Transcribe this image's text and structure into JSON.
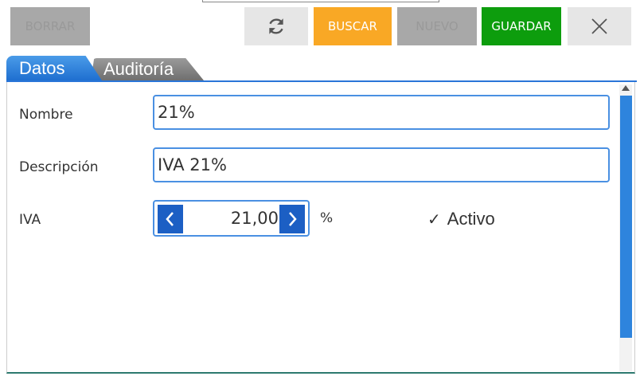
{
  "toolbar": {
    "borrar": "BORRAR",
    "buscar": "BUSCAR",
    "nuevo": "NUEVO",
    "guardar": "GUARDAR",
    "refresh_icon": "refresh-icon",
    "close_icon": "close-icon"
  },
  "tabs": [
    {
      "label": "Datos",
      "active": true
    },
    {
      "label": "Auditoría",
      "active": false
    }
  ],
  "form": {
    "nombre_label": "Nombre",
    "nombre_value": "21%",
    "descripcion_label": "Descripción",
    "descripcion_value": "IVA 21%",
    "iva_label": "IVA",
    "iva_value": "21,00",
    "iva_unit": "%",
    "activo_label": "Activo",
    "activo_checked": true
  },
  "colors": {
    "accent": "#1c5fc4",
    "buscar": "#f9a825",
    "guardar": "#0d9d0d",
    "disabled": "#a8a8a8"
  }
}
